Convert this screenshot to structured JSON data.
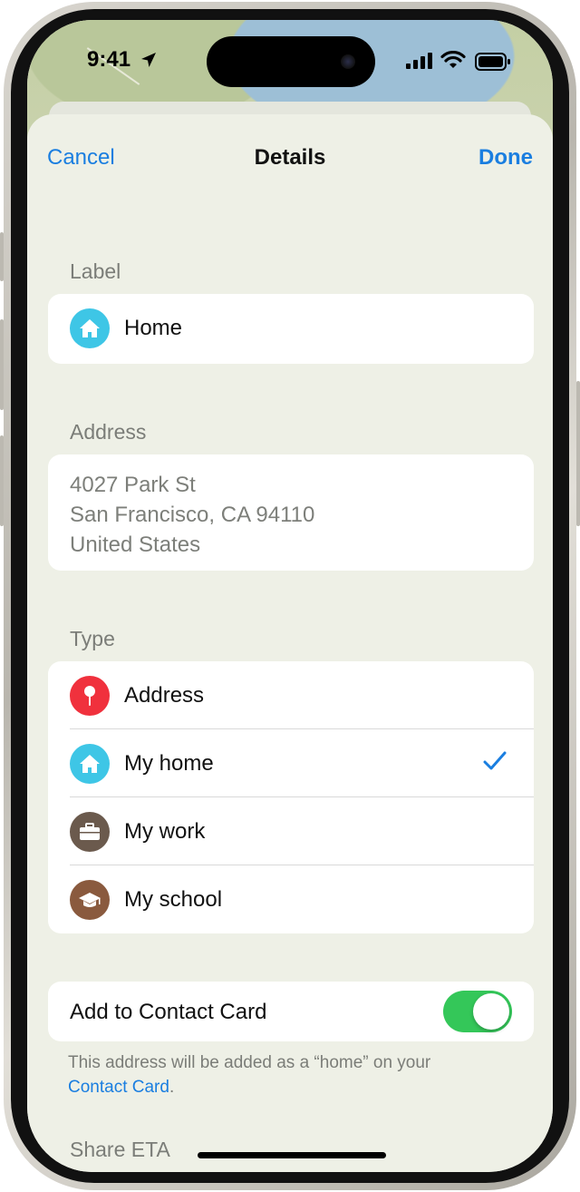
{
  "status_bar": {
    "time": "9:41"
  },
  "nav": {
    "cancel_label": "Cancel",
    "title": "Details",
    "done_label": "Done"
  },
  "label_section": {
    "header": "Label",
    "value": "Home",
    "icon": "house-icon",
    "icon_color": "#3ec6e6"
  },
  "address_section": {
    "header": "Address",
    "lines": [
      "4027 Park St",
      "San Francisco, CA  94110",
      "United States"
    ]
  },
  "type_section": {
    "header": "Type",
    "options": [
      {
        "label": "Address",
        "icon": "pin-icon",
        "color": "#f0313d",
        "selected": false
      },
      {
        "label": "My home",
        "icon": "house-icon",
        "color": "#3ec6e6",
        "selected": true
      },
      {
        "label": "My work",
        "icon": "briefcase-icon",
        "color": "#6b5a4d",
        "selected": false
      },
      {
        "label": "My school",
        "icon": "graduation-cap-icon",
        "color": "#8a5a3e",
        "selected": false
      }
    ]
  },
  "contact_section": {
    "label": "Add to Contact Card",
    "toggle_on": true,
    "footnote_prefix": "This address will be added as a “home” on your",
    "footnote_link": "Contact Card",
    "footnote_suffix": "."
  },
  "share_section": {
    "header": "Share ETA"
  },
  "colors": {
    "accent": "#1a7ee0",
    "toggle_on": "#34c759"
  }
}
